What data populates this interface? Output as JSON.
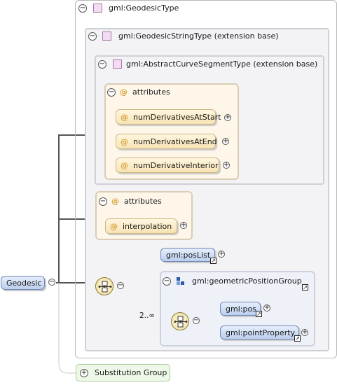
{
  "root": {
    "label": "Geodesic"
  },
  "types": {
    "geodesic": "gml:GeodesicType",
    "geodesic_string": "gml:GeodesicStringType (extension base)",
    "abstract_curve": "gml:AbstractCurveSegmentType (extension base)"
  },
  "attributes_label": "attributes",
  "abstract_attributes": [
    "numDerivativesAtStart",
    "numDerivativesAtEnd",
    "numDerivativeInterior"
  ],
  "geodesic_string_attributes": [
    "interpolation"
  ],
  "elements": {
    "pos_list": "gml:posList",
    "group": "gml:geometricPositionGroup",
    "multiplicity": "2..∞",
    "pos": "gml:pos",
    "point_property": "gml:pointProperty"
  },
  "substitution_group": "Substitution Group",
  "glyphs": {
    "minus": "−",
    "plus": "+",
    "at": "@",
    "link": "↗"
  }
}
